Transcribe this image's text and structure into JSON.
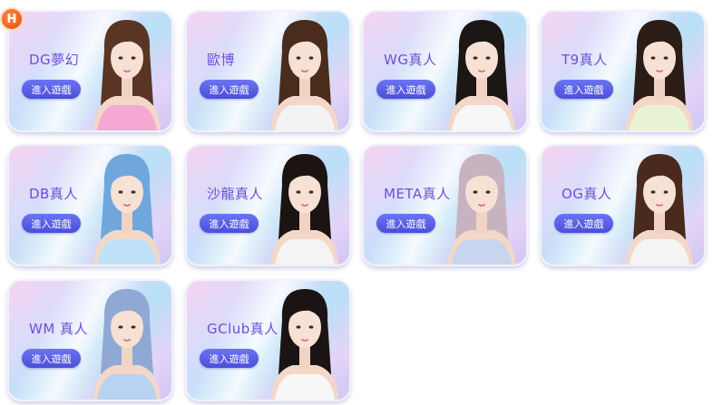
{
  "badge": {
    "label": "H"
  },
  "enter_label": "進入遊戲",
  "games": [
    {
      "title": "DG夢幻",
      "hair": "#5a3524",
      "outfit": "#f6a8d4",
      "icon": "dealer-portrait-icon"
    },
    {
      "title": "歐博",
      "hair": "#4a2c1c",
      "outfit": "#f3f3f3",
      "icon": "dealer-portrait-icon"
    },
    {
      "title": "WG真人",
      "hair": "#1c1614",
      "outfit": "#f7f7f7",
      "icon": "dealer-portrait-icon"
    },
    {
      "title": "T9真人",
      "hair": "#2b1c16",
      "outfit": "#e9f4d6",
      "icon": "dealer-portrait-icon"
    },
    {
      "title": "DB真人",
      "hair": "#6fa6dc",
      "outfit": "#bfe2f8",
      "icon": "dealer-portrait-icon"
    },
    {
      "title": "沙龍真人",
      "hair": "#1b1413",
      "outfit": "#f4f4f4",
      "icon": "dealer-portrait-icon"
    },
    {
      "title": "META真人",
      "hair": "#c7b3bf",
      "outfit": "#c9d4ee",
      "icon": "dealer-portrait-icon"
    },
    {
      "title": "OG真人",
      "hair": "#4a2a1c",
      "outfit": "#f4f4f4",
      "icon": "dealer-portrait-icon"
    },
    {
      "title": "WM 真人",
      "hair": "#8fa9d4",
      "outfit": "#b7d3f2",
      "icon": "dealer-portrait-icon"
    },
    {
      "title": "GClub真人",
      "hair": "#1a1414",
      "outfit": "#f7f7f7",
      "icon": "dealer-portrait-icon"
    }
  ]
}
